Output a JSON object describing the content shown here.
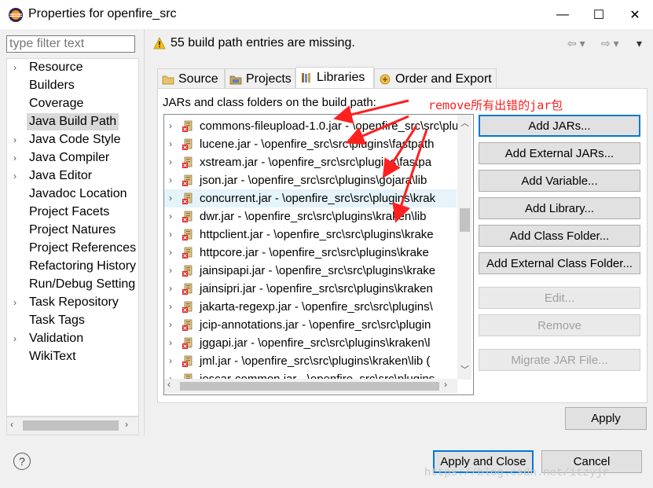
{
  "window": {
    "title": "Properties for openfire_src",
    "minimize": "—",
    "maximize": "☐",
    "close": "✕"
  },
  "filter": {
    "placeholder": "type filter text"
  },
  "tree": [
    {
      "label": "Resource",
      "expandable": true
    },
    {
      "label": "Builders",
      "expandable": false
    },
    {
      "label": "Coverage",
      "expandable": false
    },
    {
      "label": "Java Build Path",
      "expandable": false,
      "selected": true
    },
    {
      "label": "Java Code Style",
      "expandable": true
    },
    {
      "label": "Java Compiler",
      "expandable": true
    },
    {
      "label": "Java Editor",
      "expandable": true
    },
    {
      "label": "Javadoc Location",
      "expandable": false
    },
    {
      "label": "Project Facets",
      "expandable": false
    },
    {
      "label": "Project Natures",
      "expandable": false
    },
    {
      "label": "Project References",
      "expandable": false
    },
    {
      "label": "Refactoring History",
      "expandable": false
    },
    {
      "label": "Run/Debug Setting",
      "expandable": false
    },
    {
      "label": "Task Repository",
      "expandable": true
    },
    {
      "label": "Task Tags",
      "expandable": false
    },
    {
      "label": "Validation",
      "expandable": true
    },
    {
      "label": "WikiText",
      "expandable": false
    }
  ],
  "header": {
    "warning": "55 build path entries are missing."
  },
  "tabs": [
    {
      "label": "Source"
    },
    {
      "label": "Projects"
    },
    {
      "label": "Libraries",
      "active": true
    },
    {
      "label": "Order and Export"
    }
  ],
  "libraries": {
    "caption": "JARs and class folders on the build path:",
    "entries": [
      "commons-fileupload-1.0.jar - \\openfire_src\\src\\plu",
      "lucene.jar - \\openfire_src\\src\\plugins\\fastpath",
      "xstream.jar - \\openfire_src\\src\\plugins\\fastpa",
      "json.jar - \\openfire_src\\src\\plugins\\gojara\\lib",
      "concurrent.jar - \\openfire_src\\src\\plugins\\krak",
      "dwr.jar - \\openfire_src\\src\\plugins\\kraken\\lib",
      "httpclient.jar - \\openfire_src\\src\\plugins\\krake",
      "httpcore.jar - \\openfire_src\\src\\plugins\\krake",
      "jainsipapi.jar - \\openfire_src\\src\\plugins\\krake",
      "jainsipri.jar - \\openfire_src\\src\\plugins\\kraken",
      "jakarta-regexp.jar - \\openfire_src\\src\\plugins\\",
      "jcip-annotations.jar - \\openfire_src\\src\\plugin",
      "jggapi.jar - \\openfire_src\\src\\plugins\\kraken\\l",
      "jml.jar - \\openfire_src\\src\\plugins\\kraken\\lib (",
      "joscar-common.jar - \\openfire_src\\src\\plugins"
    ],
    "highlighted_index": 4
  },
  "buttons": {
    "add_jars": "Add JARs...",
    "add_external_jars": "Add External JARs...",
    "add_variable": "Add Variable...",
    "add_library": "Add Library...",
    "add_class_folder": "Add Class Folder...",
    "add_external_class_folder": "Add External Class Folder...",
    "edit": "Edit...",
    "remove": "Remove",
    "migrate": "Migrate JAR File...",
    "apply": "Apply",
    "apply_close": "Apply and Close",
    "cancel": "Cancel",
    "help": "?"
  },
  "annotation": "remove所有出错的jar包",
  "watermark": "https://blog.csdn.net/itzyjr",
  "colors": {
    "accent": "#0078d7",
    "annotation": "#ff2020",
    "selection": "#d9d9d9",
    "highlight": "#e5f3fb"
  }
}
